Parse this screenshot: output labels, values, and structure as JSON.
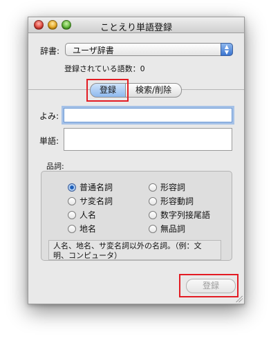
{
  "window": {
    "title": "ことえり単語登録"
  },
  "dictionary": {
    "label": "辞書:",
    "selected": "ユーザ辞書",
    "stepper_glyph_up": "▲",
    "stepper_glyph_down": "▼"
  },
  "count_text": "登録されている語数：0",
  "tabs": [
    {
      "label": "登録"
    },
    {
      "label": "検索/削除"
    }
  ],
  "reading": {
    "label": "よみ:",
    "value": ""
  },
  "word": {
    "label": "単語:",
    "value": ""
  },
  "pos": {
    "label": "品詞:",
    "options": [
      {
        "label": "普通名詞",
        "selected": true
      },
      {
        "label": "形容詞",
        "selected": false
      },
      {
        "label": "サ変名詞",
        "selected": false
      },
      {
        "label": "形容動詞",
        "selected": false
      },
      {
        "label": "人名",
        "selected": false
      },
      {
        "label": "数字列接尾語",
        "selected": false
      },
      {
        "label": "地名",
        "selected": false
      },
      {
        "label": "無品詞",
        "selected": false
      }
    ],
    "description": "人名、地名、サ変名詞以外の名詞。（例：文明、コンピュータ）"
  },
  "register_button": {
    "label": "登録"
  },
  "colors": {
    "highlight_box": "#e31b23",
    "focus_ring": "#6d9ad6"
  }
}
